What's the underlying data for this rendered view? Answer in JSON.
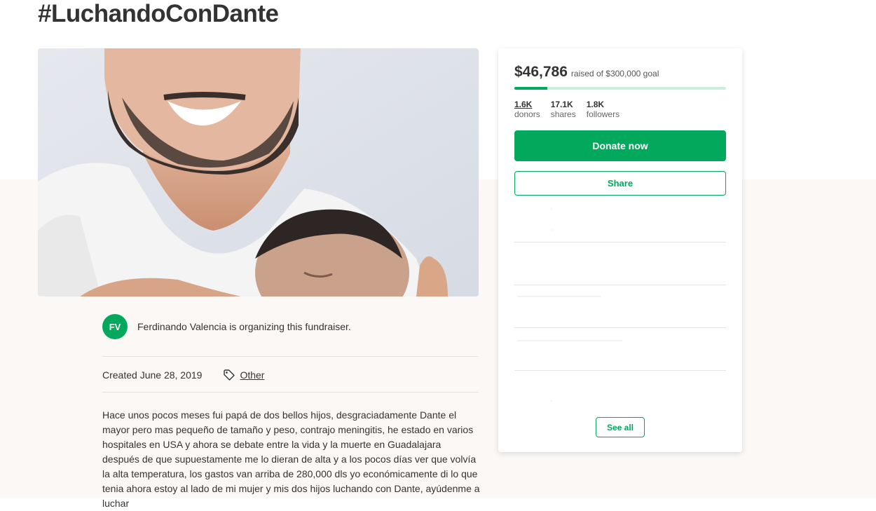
{
  "page": {
    "title": "#LuchandoConDante"
  },
  "hero": {
    "image_alt": "Man holding newborn baby"
  },
  "organizer": {
    "initials": "FV",
    "text": "Ferdinando Valencia is organizing this fundraiser."
  },
  "meta": {
    "created": "Created June 28, 2019",
    "category": "Other",
    "category_icon": "tag-icon"
  },
  "story": {
    "text": "Hace unos pocos meses fui papá de dos bellos hijos, desgraciadamente Dante el mayor pero mas pequeño de tamaño y peso, contrajo meningitis, he estado en varios hospitales en USA y ahora se debate entre la vida y la muerte en Guadalajara después de que supuestamente me lo dieran de alta y a los pocos días ver que volvía la alta temperatura, los gastos van arriba de 280,000 dls yo económicamente di lo que tenia ahora estoy al lado de mi mujer y mis dos hijos luchando con Dante, ayúdenme a luchar"
  },
  "donation_card": {
    "amount": "$46,786",
    "goal_text": "raised of $300,000 goal",
    "progress_fraction": 0.156,
    "stats": [
      {
        "value": "1.6K",
        "label": "donors"
      },
      {
        "value": "17.1K",
        "label": "shares"
      },
      {
        "value": "1.8K",
        "label": "followers"
      }
    ],
    "donate_label": "Donate now",
    "share_label": "Share",
    "see_all_label": "See all"
  },
  "colors": {
    "brand_green": "#02a95c",
    "progress_track": "#cbeedd",
    "lower_background": "#fbf8f6"
  }
}
